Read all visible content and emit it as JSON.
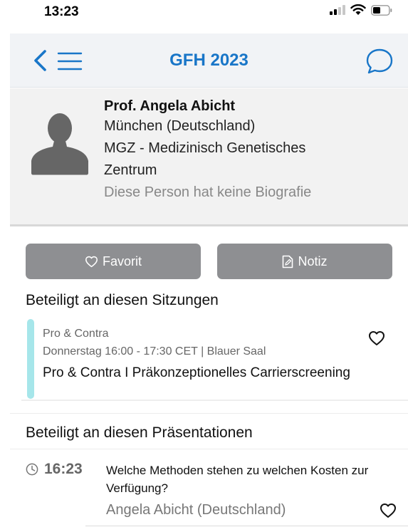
{
  "status_bar": {
    "time": "13:23",
    "icons": [
      "signal-icon",
      "wifi-icon",
      "battery-icon"
    ]
  },
  "header": {
    "title": "GFH 2023",
    "icons": [
      "back-icon",
      "menu-icon",
      "chat-icon"
    ],
    "accent_color": "#1976c8"
  },
  "profile": {
    "name": "Prof. Angela Abicht",
    "location": "München (Deutschland)",
    "institution_line1": "MGZ - Medizinisch Genetisches",
    "institution_line2": "Zentrum",
    "bio": "Diese Person hat keine Biografie"
  },
  "actions": {
    "favorite_label": "Favorit",
    "note_label": "Notiz"
  },
  "sessions": {
    "section_title": "Beteiligt an diesen Sitzungen",
    "items": [
      {
        "category": "Pro & Contra",
        "time_location": "Donnerstag 16:00 - 17:30 CET | Blauer Saal",
        "title": "Pro & Contra I Präkonzeptionelles Carrierscreening",
        "bar_color": "#a6e6ea"
      }
    ]
  },
  "presentations": {
    "section_title": "Beteiligt an diesen Präsentationen",
    "items": [
      {
        "time": "16:23",
        "title": "Welche Methoden stehen zu welchen Kosten zur Verfügung?",
        "author": "Angela Abicht (Deutschland)"
      }
    ]
  }
}
